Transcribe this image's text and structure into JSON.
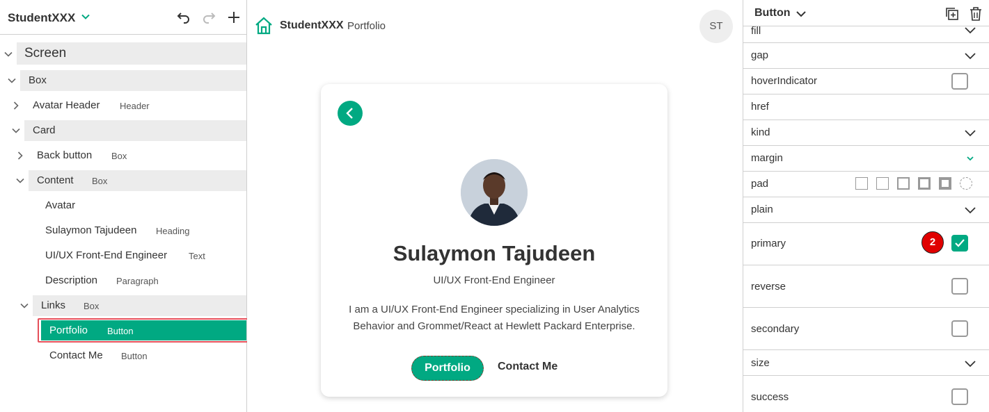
{
  "left_panel": {
    "project_name": "StudentXXX",
    "tree": [
      {
        "label": "Screen"
      },
      {
        "label": "Box"
      },
      {
        "label": "Avatar Header",
        "type": "Header"
      },
      {
        "label": "Card"
      },
      {
        "label": "Back button",
        "type": "Box"
      },
      {
        "label": "Content",
        "type": "Box"
      },
      {
        "label": "Avatar"
      },
      {
        "label": "Sulaymon Tajudeen",
        "type": "Heading"
      },
      {
        "label": "UI/UX Front-End Engineer",
        "type": "Text"
      },
      {
        "label": "Description",
        "type": "Paragraph"
      },
      {
        "label": "Links",
        "type": "Box"
      },
      {
        "label": "Portfolio",
        "type": "Button"
      },
      {
        "label": "Contact Me",
        "type": "Button"
      }
    ]
  },
  "canvas": {
    "header": {
      "brand": "StudentXXX",
      "page": "Portfolio",
      "avatar_initials": "ST"
    },
    "card": {
      "name": "Sulaymon Tajudeen",
      "role": "UI/UX Front-End Engineer",
      "description": "I am a UI/UX Front-End Engineer specializing in User Analytics Behavior and Grommet/React at Hewlett Packard Enterprise.",
      "primary_button": "Portfolio",
      "secondary_button": "Contact Me"
    }
  },
  "right_panel": {
    "component": "Button",
    "badge": "2",
    "props": [
      {
        "name": "fill"
      },
      {
        "name": "gap"
      },
      {
        "name": "hoverIndicator"
      },
      {
        "name": "href"
      },
      {
        "name": "kind"
      },
      {
        "name": "margin"
      },
      {
        "name": "pad"
      },
      {
        "name": "plain"
      },
      {
        "name": "primary"
      },
      {
        "name": "reverse"
      },
      {
        "name": "secondary"
      },
      {
        "name": "size"
      },
      {
        "name": "success"
      }
    ]
  },
  "colors": {
    "accent": "#01a982",
    "selection_outline": "#e5505a",
    "badge": "#e00000"
  }
}
